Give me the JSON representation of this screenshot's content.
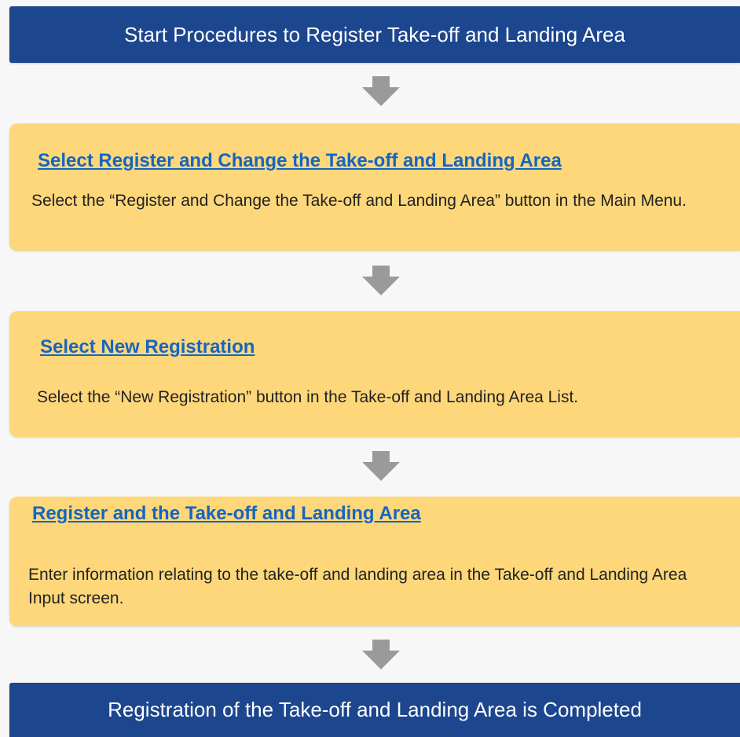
{
  "start": {
    "label": "Start Procedures to Register Take-off and Landing Area"
  },
  "steps": [
    {
      "title": "Select Register and Change the Take-off and Landing Area",
      "description": "Select the “Register and Change the Take-off and Landing Area” button in the Main Menu."
    },
    {
      "title": "Select New Registration",
      "description": "Select the “New Registration” button in the Take-off and Landing Area List."
    },
    {
      "title": "Register and the Take-off and Landing Area",
      "description": "Enter information relating to the take-off and landing area in the Take-off and Landing Area Input screen."
    }
  ],
  "end": {
    "label": "Registration of the Take-off and Landing Area is Completed"
  },
  "colors": {
    "banner": "#1c468e",
    "step_box": "#fed77b",
    "step_title": "#1565c0",
    "arrow": "#9a9a9a"
  },
  "icons": {
    "connector": "down-arrow-icon"
  }
}
